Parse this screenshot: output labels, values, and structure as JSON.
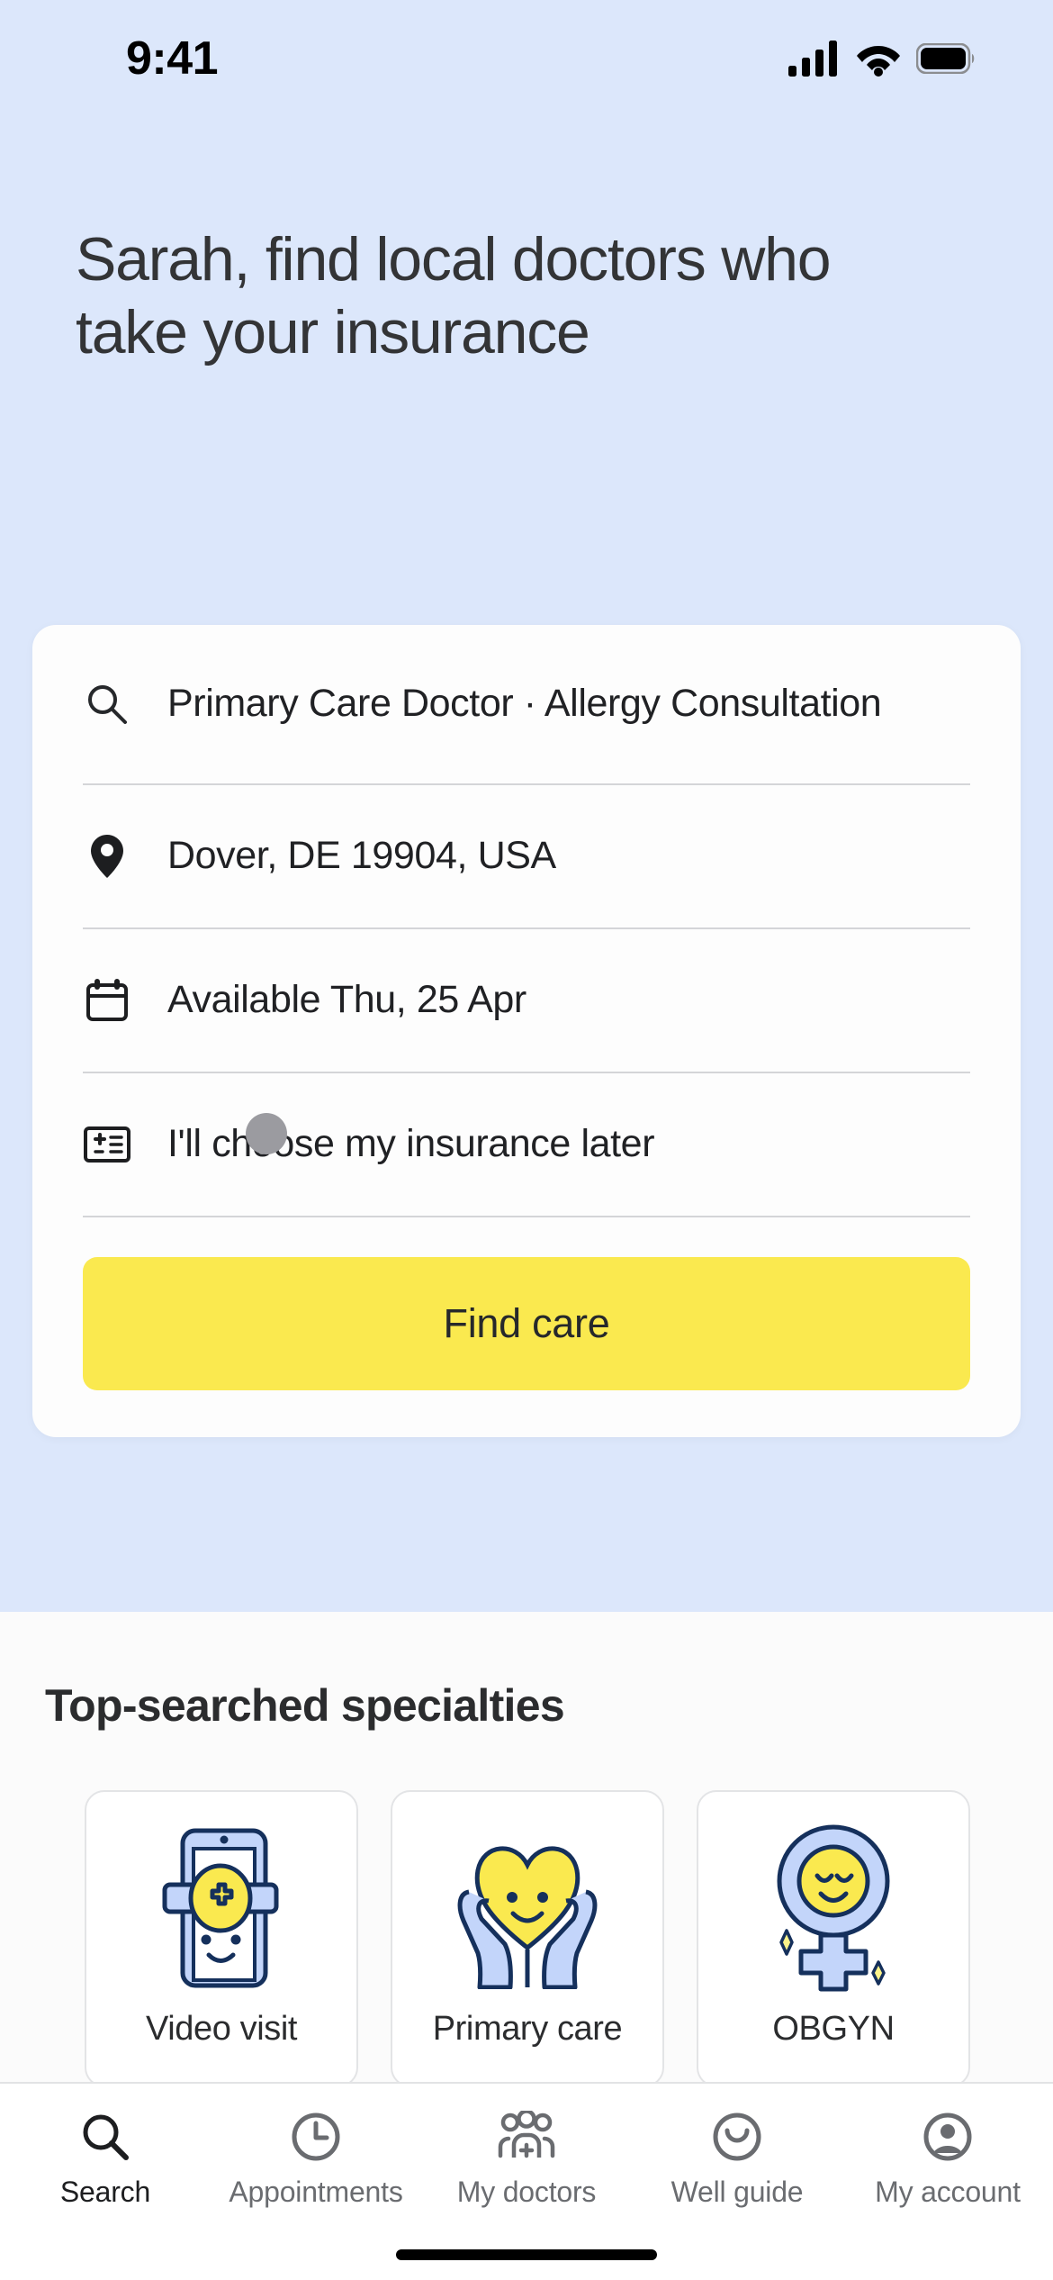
{
  "statusbar": {
    "time": "9:41",
    "cellular_icon": "cellular-signal-icon",
    "wifi_icon": "wifi-icon",
    "battery_icon": "battery-full-icon"
  },
  "hero": {
    "headline": "Sarah, find local doctors who take your insurance",
    "background_color": "#dce7fb"
  },
  "search_card": {
    "specialty": {
      "icon": "search-icon",
      "value": "Primary Care Doctor · Allergy Consultation"
    },
    "location": {
      "icon": "location-pin-icon",
      "value": "Dover, DE 19904, USA"
    },
    "date": {
      "icon": "calendar-icon",
      "value": "Available Thu, 25 Apr"
    },
    "insurance": {
      "icon": "insurance-card-icon",
      "value": "I'll choose my insurance later"
    },
    "submit_label": "Find care",
    "submit_color": "#fae94f"
  },
  "specialties": {
    "title": "Top-searched specialties",
    "cards": [
      {
        "label": "Video visit",
        "art": "phone-medical-cross-face-illustration"
      },
      {
        "label": "Primary care",
        "art": "hands-holding-heart-illustration"
      },
      {
        "label": "OBGYN",
        "art": "venus-symbol-face-illustration"
      }
    ]
  },
  "bottom_nav": {
    "items": [
      {
        "label": "Search",
        "icon": "search-icon",
        "active": true
      },
      {
        "label": "Appointments",
        "icon": "clock-icon",
        "active": false
      },
      {
        "label": "My doctors",
        "icon": "doctors-group-icon",
        "active": false
      },
      {
        "label": "Well guide",
        "icon": "smiley-face-icon",
        "active": false
      },
      {
        "label": "My account",
        "icon": "account-circle-icon",
        "active": false
      }
    ]
  },
  "colors": {
    "accent_yellow": "#fae94f",
    "hero_blue": "#dce7fb",
    "illustration_blue": "#c3d5fa",
    "illustration_outline": "#15305c"
  }
}
